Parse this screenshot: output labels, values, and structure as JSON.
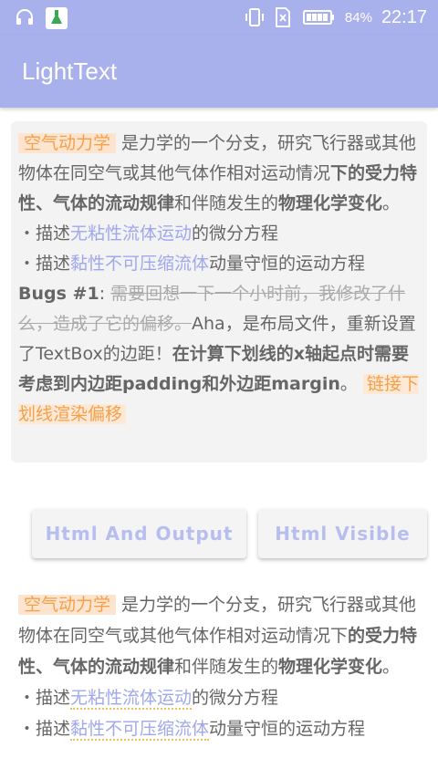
{
  "status_bar": {
    "battery_pct": "84%",
    "time": "22:17",
    "icons": [
      "headset-icon",
      "cleaner-app-icon",
      "vibrate-icon",
      "no-sim-icon",
      "battery-icon"
    ]
  },
  "app_bar": {
    "title": "LightText"
  },
  "card": {
    "tag1": "空气动力学",
    "t1": " 是力学的一个分支，研究飞行器或其他物体在同空气或其他气体作相对运动情况",
    "b1": "下的受力特性、气体的流动规律",
    "t2": "和伴随发生的",
    "b2": "物理化学变化",
    "t3": "。",
    "bullet1_prefix": "・描述",
    "bullet1_link": "无粘性流体运动",
    "bullet1_suffix": "的微分方程",
    "bullet2_prefix": "・描述",
    "bullet2_link": "黏性不可压缩流体",
    "bullet2_suffix": "动量守恒的运动方程",
    "bugs_label": "Bugs #1",
    "bugs_colon": ": ",
    "strike_text": "需要回想一下一个小时前，我修改了什么，造成了它的偏移。",
    "t4": "Aha，是布局文件，重新设置了TextBox的边距！",
    "b3": "在计算下划线的x轴起点时需要考虑到内边距padding和外边距margin",
    "t5": "。 ",
    "tag2": "链接下划线渲染偏移"
  },
  "buttons": {
    "html_output": "Html And Output",
    "html_visible": "Html Visible"
  },
  "bottom": {
    "tag1": "空气动力学",
    "t1": " 是力学的一个分支，研究飞行器或其他物体在同空气或其他气体作相对运动情况下",
    "b1": "的受力特性、气体的流动规律",
    "t2": "和伴随发生的",
    "b2": "物理化学变化",
    "t3": "。",
    "bullet1_prefix": "・描述",
    "bullet1_link": "无粘性流体运动",
    "bullet1_suffix": "的微分方程",
    "bullet2_prefix": "・描述",
    "bullet2_link": "黏性不可压缩流体",
    "bullet2_suffix": "动量守恒的运动方程"
  }
}
